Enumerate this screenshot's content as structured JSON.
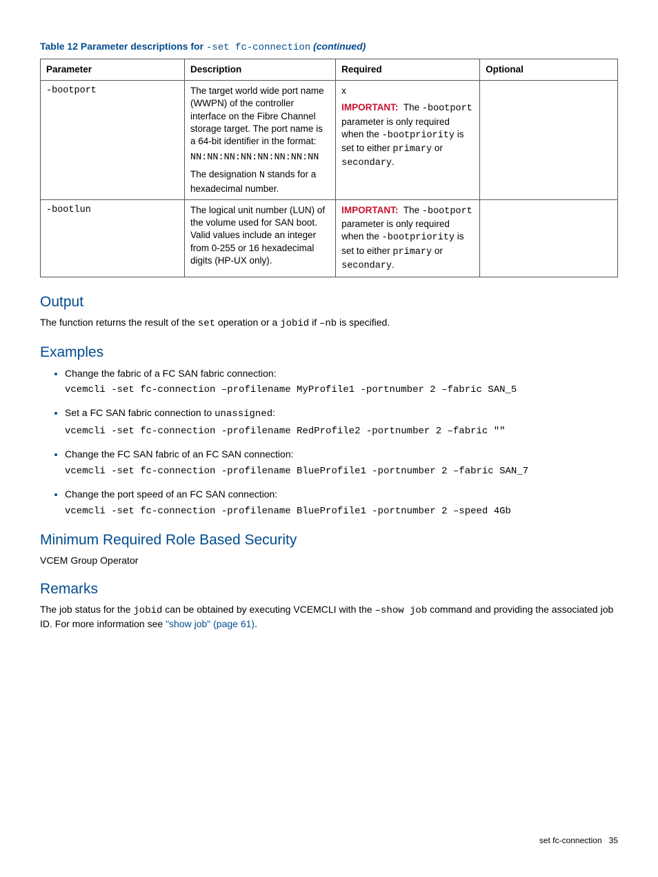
{
  "caption": {
    "prefix": "Table 12 Parameter descriptions for ",
    "code": "-set fc-connection",
    "suffix": " (continued)"
  },
  "headers": {
    "c1": "Parameter",
    "c2": "Description",
    "c3": "Required",
    "c4": "Optional"
  },
  "row1": {
    "param": "-bootport",
    "desc1": "The target world wide port name (WWPN) of the controller interface on the Fibre Channel storage target. The port name is a 64-bit identifier in the format:",
    "desc_code": "NN:NN:NN:NN:NN:NN:NN:NN",
    "desc2a": "The designation ",
    "desc2_code": "N",
    "desc2b": " stands for a hexadecimal number.",
    "req_x": "x",
    "imp_label": "IMPORTANT:",
    "imp_t1": "The ",
    "imp_c1": "-bootport",
    "imp_t2": " parameter is only required when the ",
    "imp_c2": "-bootpriority",
    "imp_t3": " is set to either ",
    "imp_c3": "primary",
    "imp_t4": " or ",
    "imp_c4": "secondary",
    "imp_t5": "."
  },
  "row2": {
    "param": "-bootlun",
    "desc": "The logical unit number (LUN) of the volume used for SAN boot. Valid values include an integer from 0-255 or 16 hexadecimal digits (HP-UX only).",
    "imp_label": "IMPORTANT:",
    "imp_t1": "The ",
    "imp_c1": "-bootport",
    "imp_t2": " parameter is only required when the ",
    "imp_c2": "-bootpriority",
    "imp_t3": " is set to either ",
    "imp_c3": "primary",
    "imp_t4": " or ",
    "imp_c4": "secondary",
    "imp_t5": "."
  },
  "output": {
    "heading": "Output",
    "p_a": "The function returns the result of the ",
    "p_c1": "set",
    "p_b": " operation or a ",
    "p_c2": "jobid",
    "p_c": " if ",
    "p_c3": "–nb",
    "p_d": " is specified."
  },
  "examples": {
    "heading": "Examples",
    "items": [
      {
        "lead": "Change the fabric of a FC SAN fabric connection:",
        "cmd": "vcemcli -set fc-connection –profilename MyProfile1 -portnumber 2 –fabric SAN_5"
      },
      {
        "lead_a": "Set a FC SAN fabric connection to ",
        "lead_code": "unassigned",
        "lead_b": ":",
        "cmd": "vcemcli -set fc-connection -profilename RedProfile2 -portnumber 2 –fabric \"\""
      },
      {
        "lead": "Change the FC SAN fabric of an FC SAN connection:",
        "cmd": "vcemcli -set fc-connection -profilename BlueProfile1 -portnumber 2 –fabric SAN_7"
      },
      {
        "lead": "Change the port speed of an FC SAN connection:",
        "cmd": "vcemcli -set fc-connection -profilename BlueProfile1 -portnumber 2 –speed 4Gb"
      }
    ]
  },
  "security": {
    "heading": "Minimum Required Role Based Security",
    "body": "VCEM Group Operator"
  },
  "remarks": {
    "heading": "Remarks",
    "a": "The job status for the ",
    "c1": "jobid",
    "b": " can be obtained by executing VCEMCLI with the ",
    "c2": "–show job",
    "c": " command and providing the associated job ID. For more information see ",
    "link": "\"show job\" (page 61)",
    "d": "."
  },
  "footer": {
    "label": "set fc-connection",
    "page": "35"
  }
}
